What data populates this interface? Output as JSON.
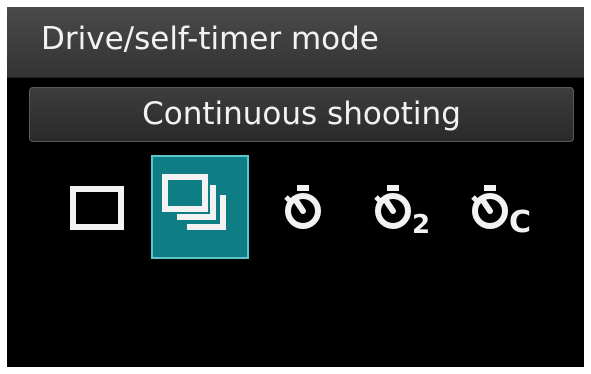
{
  "header": {
    "title": "Drive/self-timer mode"
  },
  "selected_mode": {
    "label": "Continuous shooting"
  },
  "drive_modes": [
    {
      "icon": "single-shot-icon",
      "selected": false
    },
    {
      "icon": "continuous-shooting-icon",
      "selected": true
    },
    {
      "icon": "self-timer-icon",
      "selected": false
    },
    {
      "icon": "self-timer-2sec-icon",
      "selected": false,
      "suffix": "2"
    },
    {
      "icon": "self-timer-continuous-icon",
      "selected": false,
      "suffix": "C"
    }
  ],
  "colors": {
    "screen_background": "#000000",
    "selection_fill": "#0f7d84",
    "selection_border": "#5bc6cc",
    "text": "#f2f2f2"
  }
}
